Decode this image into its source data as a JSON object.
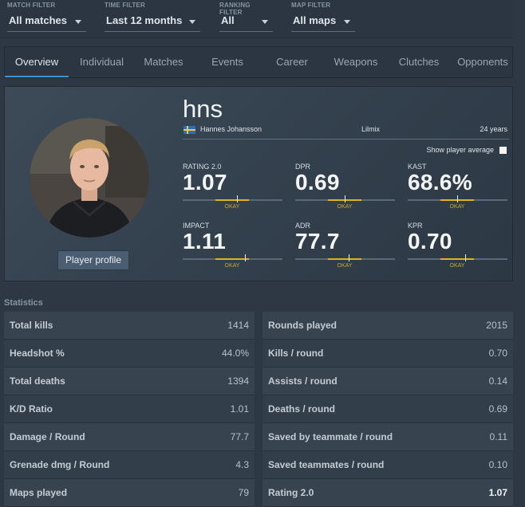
{
  "filters": [
    {
      "label": "MATCH FILTER",
      "value": "All matches"
    },
    {
      "label": "TIME FILTER",
      "value": "Last 12 months"
    },
    {
      "label": "RANKING FILTER",
      "value": "All"
    },
    {
      "label": "MAP FILTER",
      "value": "All maps"
    }
  ],
  "tabs": [
    "Overview",
    "Individual",
    "Matches",
    "Events",
    "Career",
    "Weapons",
    "Clutches",
    "Opponents"
  ],
  "active_tab": "Overview",
  "player": {
    "nickname": "hns",
    "real_name": "Hannes Johansson",
    "team": "Lilmix",
    "age": "24 years",
    "country_flag": "sweden-flag",
    "profile_button": "Player profile",
    "show_average_label": "Show player average",
    "show_average_checked": false
  },
  "summary_stats": [
    {
      "label": "RATING 2.0",
      "value": "1.07",
      "grade": "OKAY",
      "marker_fraction": 0.55
    },
    {
      "label": "DPR",
      "value": "0.69",
      "grade": "OKAY",
      "marker_fraction": 0.5
    },
    {
      "label": "KAST",
      "value": "68.6%",
      "grade": "OKAY",
      "marker_fraction": 0.5
    },
    {
      "label": "IMPACT",
      "value": "1.11",
      "grade": "OKAY",
      "marker_fraction": 0.63
    },
    {
      "label": "ADR",
      "value": "77.7",
      "grade": "OKAY",
      "marker_fraction": 0.54
    },
    {
      "label": "KPR",
      "value": "0.70",
      "grade": "OKAY",
      "marker_fraction": 0.58
    }
  ],
  "statistics": {
    "title": "Statistics",
    "left": [
      {
        "label": "Total kills",
        "value": "1414"
      },
      {
        "label": "Headshot %",
        "value": "44.0%"
      },
      {
        "label": "Total deaths",
        "value": "1394"
      },
      {
        "label": "K/D Ratio",
        "value": "1.01"
      },
      {
        "label": "Damage / Round",
        "value": "77.7"
      },
      {
        "label": "Grenade dmg / Round",
        "value": "4.3"
      },
      {
        "label": "Maps played",
        "value": "79"
      }
    ],
    "right": [
      {
        "label": "Rounds played",
        "value": "2015"
      },
      {
        "label": "Kills / round",
        "value": "0.70"
      },
      {
        "label": "Assists / round",
        "value": "0.14"
      },
      {
        "label": "Deaths / round",
        "value": "0.69"
      },
      {
        "label": "Saved by teammate / round",
        "value": "0.11"
      },
      {
        "label": "Saved teammates / round",
        "value": "0.10"
      },
      {
        "label": "Rating 2.0",
        "value": "1.07",
        "highlight": true
      }
    ]
  },
  "colors": {
    "background": "#2d3844",
    "accent_blue": "#3f92d2",
    "okay_yellow": "#e0b318"
  }
}
